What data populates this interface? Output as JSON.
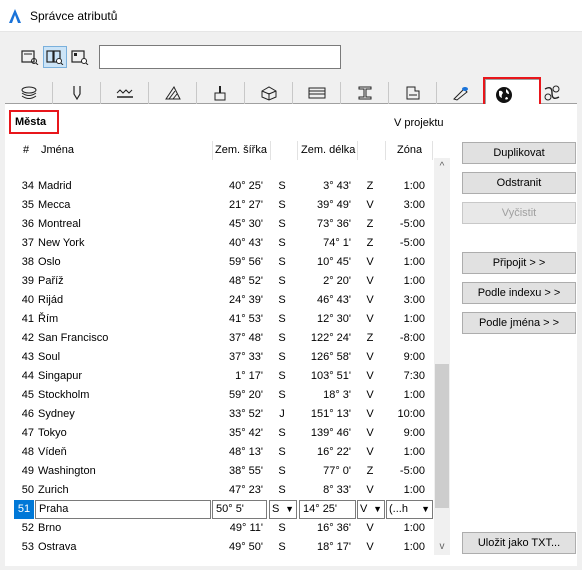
{
  "window": {
    "title": "Správce atributů"
  },
  "search": {
    "value": "",
    "placeholder": ""
  },
  "view_buttons": [
    {
      "icon": "list-view-icon",
      "active": false
    },
    {
      "icon": "list-detail-view-icon",
      "active": true
    },
    {
      "icon": "detail-view-icon",
      "active": false
    }
  ],
  "tabs": [
    {
      "icon": "layers-icon"
    },
    {
      "icon": "pen-icon"
    },
    {
      "icon": "line-types-icon"
    },
    {
      "icon": "fill-icon"
    },
    {
      "icon": "brush-icon"
    },
    {
      "icon": "composites-icon"
    },
    {
      "icon": "profile-hatch-icon"
    },
    {
      "icon": "profile-icon"
    },
    {
      "icon": "zone-category-icon"
    },
    {
      "icon": "surface-icon"
    },
    {
      "icon": "globe-icon",
      "selected": true
    },
    {
      "icon": "mep-icon"
    }
  ],
  "section": {
    "title": "Města",
    "right_label": "V projektu"
  },
  "columns": {
    "num": "#",
    "name": "Jména",
    "lat": "Zem. šířka",
    "lat_dir": "",
    "lon": "Zem. délka",
    "lon_dir": "",
    "zone": "Zóna"
  },
  "rows": [
    {
      "num": "34",
      "name": "Madrid",
      "lat": "40° 25'",
      "lat_dir": "S",
      "lon": "3° 43'",
      "lon_dir": "Z",
      "zone": "1:00"
    },
    {
      "num": "35",
      "name": "Mecca",
      "lat": "21° 27'",
      "lat_dir": "S",
      "lon": "39° 49'",
      "lon_dir": "V",
      "zone": "3:00"
    },
    {
      "num": "36",
      "name": "Montreal",
      "lat": "45° 30'",
      "lat_dir": "S",
      "lon": "73° 36'",
      "lon_dir": "Z",
      "zone": "-5:00"
    },
    {
      "num": "37",
      "name": "New York",
      "lat": "40° 43'",
      "lat_dir": "S",
      "lon": "74° 1'",
      "lon_dir": "Z",
      "zone": "-5:00"
    },
    {
      "num": "38",
      "name": "Oslo",
      "lat": "59° 56'",
      "lat_dir": "S",
      "lon": "10° 45'",
      "lon_dir": "V",
      "zone": "1:00"
    },
    {
      "num": "39",
      "name": "Paříž",
      "lat": "48° 52'",
      "lat_dir": "S",
      "lon": "2° 20'",
      "lon_dir": "V",
      "zone": "1:00"
    },
    {
      "num": "40",
      "name": "Rijád",
      "lat": "24° 39'",
      "lat_dir": "S",
      "lon": "46° 43'",
      "lon_dir": "V",
      "zone": "3:00"
    },
    {
      "num": "41",
      "name": "Řím",
      "lat": "41° 53'",
      "lat_dir": "S",
      "lon": "12° 30'",
      "lon_dir": "V",
      "zone": "1:00"
    },
    {
      "num": "42",
      "name": "San Francisco",
      "lat": "37° 48'",
      "lat_dir": "S",
      "lon": "122° 24'",
      "lon_dir": "Z",
      "zone": "-8:00"
    },
    {
      "num": "43",
      "name": "Soul",
      "lat": "37° 33'",
      "lat_dir": "S",
      "lon": "126° 58'",
      "lon_dir": "V",
      "zone": "9:00"
    },
    {
      "num": "44",
      "name": "Singapur",
      "lat": "1° 17'",
      "lat_dir": "S",
      "lon": "103° 51'",
      "lon_dir": "V",
      "zone": "7:30"
    },
    {
      "num": "45",
      "name": "Stockholm",
      "lat": "59° 20'",
      "lat_dir": "S",
      "lon": "18° 3'",
      "lon_dir": "V",
      "zone": "1:00"
    },
    {
      "num": "46",
      "name": "Sydney",
      "lat": "33° 52'",
      "lat_dir": "J",
      "lon": "151° 13'",
      "lon_dir": "V",
      "zone": "10:00"
    },
    {
      "num": "47",
      "name": "Tokyo",
      "lat": "35° 42'",
      "lat_dir": "S",
      "lon": "139° 46'",
      "lon_dir": "V",
      "zone": "9:00"
    },
    {
      "num": "48",
      "name": "Vídeň",
      "lat": "48° 13'",
      "lat_dir": "S",
      "lon": "16° 22'",
      "lon_dir": "V",
      "zone": "1:00"
    },
    {
      "num": "49",
      "name": "Washington",
      "lat": "38° 55'",
      "lat_dir": "S",
      "lon": "77° 0'",
      "lon_dir": "Z",
      "zone": "-5:00"
    },
    {
      "num": "50",
      "name": "Zurich",
      "lat": "47° 23'",
      "lat_dir": "S",
      "lon": "8° 33'",
      "lon_dir": "V",
      "zone": "1:00"
    }
  ],
  "edit_row": {
    "num": "51",
    "name": "Praha",
    "lat": "50° 5'",
    "lat_dir": "S",
    "lon": "14° 25'",
    "lon_dir": "V",
    "zone": "(...h"
  },
  "rows_after": [
    {
      "num": "52",
      "name": "Brno",
      "lat": "49° 11'",
      "lat_dir": "S",
      "lon": "16° 36'",
      "lon_dir": "V",
      "zone": "1:00"
    },
    {
      "num": "53",
      "name": "Ostrava",
      "lat": "49° 50'",
      "lat_dir": "S",
      "lon": "18° 17'",
      "lon_dir": "V",
      "zone": "1:00"
    }
  ],
  "buttons": {
    "duplicate": "Duplikovat",
    "remove": "Odstranit",
    "clean": "Vyčistit",
    "attach": "Připojit > >",
    "by_index": "Podle indexu > >",
    "by_name": "Podle jména > >",
    "save_txt": "Uložit jako TXT..."
  },
  "colors": {
    "highlight": "#e8161b",
    "selection": "#0078d7",
    "active_view": "#cce4f7"
  }
}
